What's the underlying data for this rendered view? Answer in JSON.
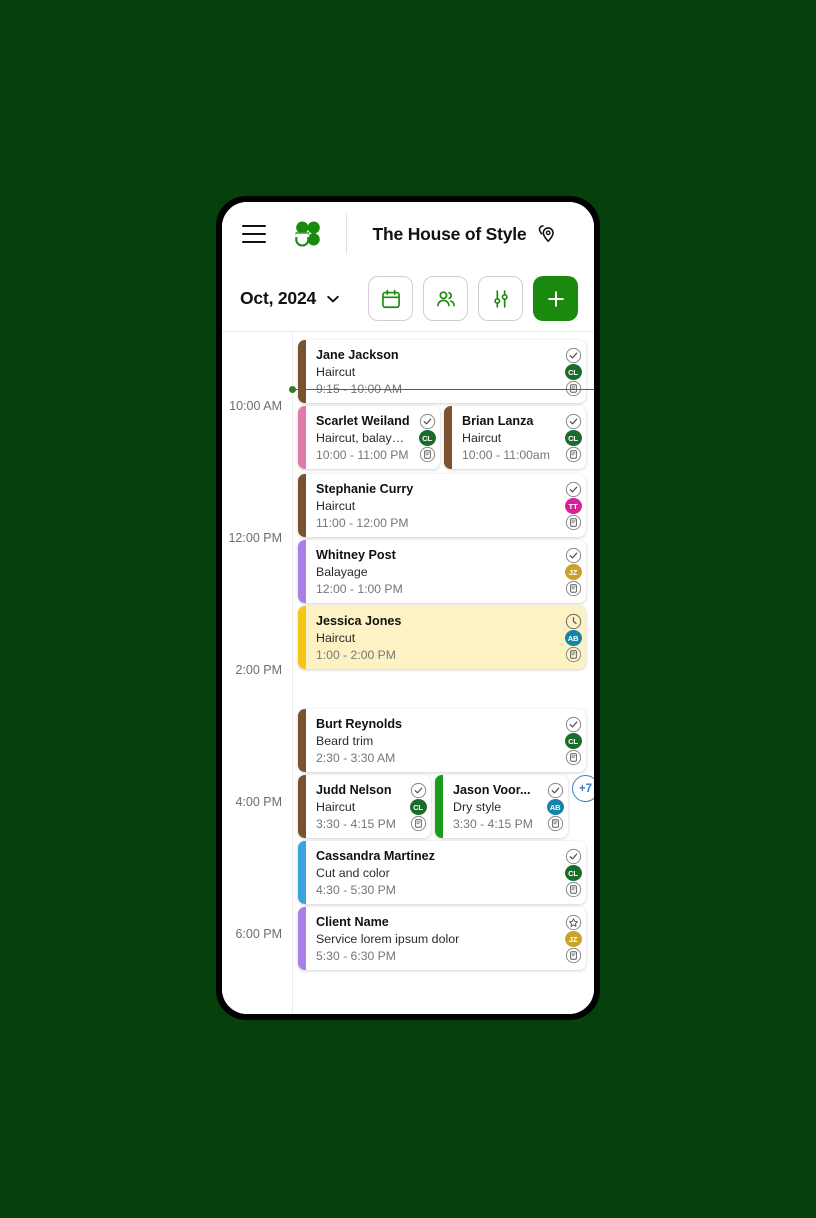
{
  "header": {
    "menu_icon": "hamburger-menu-icon",
    "logo_icon": "clover-logo-icon",
    "title": "The House of Style",
    "location_icon": "map-pins-icon"
  },
  "toolbar": {
    "month_label": "Oct, 2024",
    "chevron_icon": "chevron-down-icon",
    "buttons": [
      {
        "name": "calendar-view-button",
        "icon": "calendar-icon"
      },
      {
        "name": "staff-button",
        "icon": "people-icon"
      },
      {
        "name": "filters-button",
        "icon": "sliders-icon"
      },
      {
        "name": "add-appointment-button",
        "icon": "plus-icon"
      }
    ]
  },
  "agenda": {
    "time_ticks": [
      "10:00 AM",
      "12:00 PM",
      "2:00 PM",
      "4:00 PM",
      "6:00 PM"
    ],
    "now_indicator": true,
    "more_badge": "+7",
    "appointments": [
      {
        "client": "Jane Jackson",
        "service": "Haircut",
        "time": "9:15 - 10:00 AM",
        "bar_color": "#7a5230",
        "status_icon": "check-circle-icon",
        "avatar_initials": "CL",
        "avatar_color": "#1b6b2a",
        "note_icon": "note-icon",
        "highlight": false
      },
      {
        "client": "Scarlet Weiland",
        "service": "Haircut, balayage",
        "time": "10:00 - 11:00 PM",
        "bar_color": "#e07aad",
        "status_icon": "check-circle-icon",
        "avatar_initials": "CL",
        "avatar_color": "#1b6b2a",
        "note_icon": "note-icon",
        "highlight": false
      },
      {
        "client": "Brian Lanza",
        "service": "Haircut",
        "time": "10:00 - 11:00am",
        "bar_color": "#7a5230",
        "status_icon": "check-circle-icon",
        "avatar_initials": "CL",
        "avatar_color": "#1b6b2a",
        "note_icon": "note-icon",
        "highlight": false
      },
      {
        "client": "Stephanie Curry",
        "service": "Haircut",
        "time": "11:00 - 12:00 PM",
        "bar_color": "#7a5230",
        "status_icon": "check-circle-icon",
        "avatar_initials": "TT",
        "avatar_color": "#d91f9a",
        "note_icon": "note-icon",
        "highlight": false
      },
      {
        "client": "Whitney Post",
        "service": "Balayage",
        "time": "12:00 - 1:00 PM",
        "bar_color": "#a87fe8",
        "status_icon": "check-circle-icon",
        "avatar_initials": "JZ",
        "avatar_color": "#c9a227",
        "note_icon": "note-icon",
        "highlight": false
      },
      {
        "client": "Jessica Jones",
        "service": "Haircut",
        "time": "1:00 - 2:00 PM",
        "bar_color": "#f5c518",
        "status_icon": "clock-circle-icon",
        "avatar_initials": "AB",
        "avatar_color": "#1484a8",
        "note_icon": "note-icon",
        "highlight": true
      },
      {
        "client": "Burt Reynolds",
        "service": "Beard trim",
        "time": "2:30 - 3:30 AM",
        "bar_color": "#7a5230",
        "status_icon": "check-circle-icon",
        "avatar_initials": "CL",
        "avatar_color": "#1b6b2a",
        "note_icon": "note-icon",
        "highlight": false
      },
      {
        "client": "Judd Nelson",
        "service": "Haircut",
        "time": "3:30 - 4:15 PM",
        "bar_color": "#7a5230",
        "status_icon": "check-circle-icon",
        "avatar_initials": "CL",
        "avatar_color": "#1b6b2a",
        "note_icon": "note-icon",
        "highlight": false
      },
      {
        "client": "Jason Voor...",
        "service": "Dry style",
        "time": "3:30 - 4:15 PM",
        "bar_color": "#1a9c1a",
        "status_icon": "check-circle-icon",
        "avatar_initials": "AB",
        "avatar_color": "#1484a8",
        "note_icon": "note-icon",
        "highlight": false
      },
      {
        "client": "Cassandra Martinez",
        "service": "Cut and color",
        "time": "4:30 - 5:30 PM",
        "bar_color": "#3aa3e0",
        "status_icon": "check-circle-icon",
        "avatar_initials": "CL",
        "avatar_color": "#1b6b2a",
        "note_icon": "note-icon",
        "highlight": false
      },
      {
        "client": "Client Name",
        "service": "Service lorem ipsum dolor",
        "time": "5:30 - 6:30 PM",
        "bar_color": "#a87fe8",
        "status_icon": "star-circle-icon",
        "avatar_initials": "JZ",
        "avatar_color": "#c9a227",
        "note_icon": "note-icon",
        "highlight": false
      }
    ]
  },
  "colors": {
    "brand_green": "#1a8a0e",
    "page_background": "#06400c",
    "now_line": "#2f7d1e",
    "badge_blue": "#2f80d0"
  }
}
